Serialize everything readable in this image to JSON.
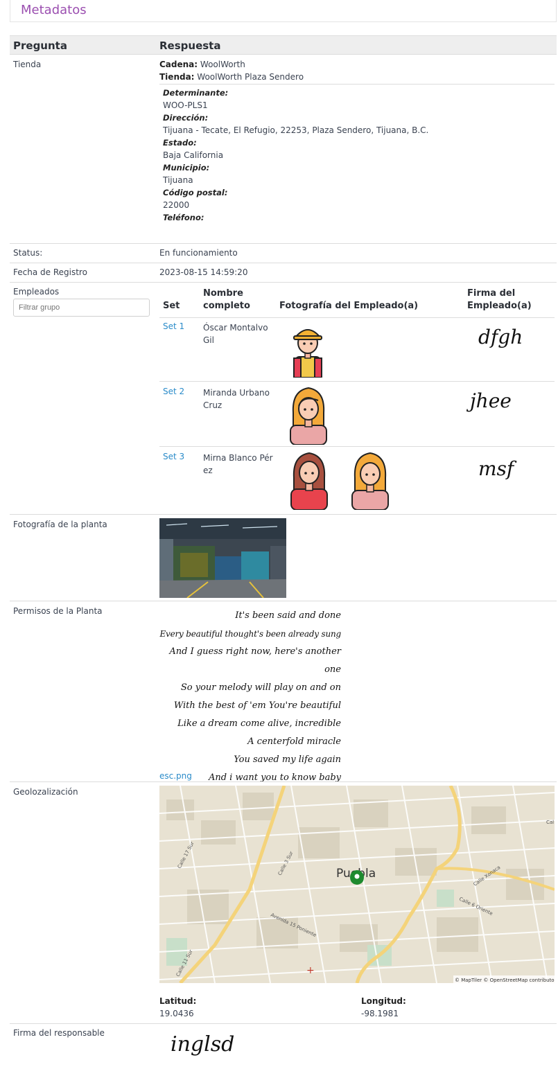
{
  "panel": {
    "title": "Metadatos"
  },
  "table": {
    "col_question": "Pregunta",
    "col_answer": "Respuesta"
  },
  "store": {
    "label": "Tienda",
    "chain_label": "Cadena:",
    "chain_value": "WoolWorth",
    "store_label": "Tienda:",
    "store_value": "WoolWorth Plaza Sendero",
    "fields": [
      {
        "label": "Determinante:",
        "value": "WOO-PLS1"
      },
      {
        "label": "Dirección:",
        "value": "Tijuana - Tecate, El Refugio, 22253, Plaza Sendero, Tijuana, B.C."
      },
      {
        "label": "Estado:",
        "value": "Baja California"
      },
      {
        "label": "Municipio:",
        "value": "Tijuana"
      },
      {
        "label": "Código postal:",
        "value": "22000"
      },
      {
        "label": "Teléfono:",
        "value": ""
      }
    ]
  },
  "status": {
    "label": "Status:",
    "value": "En funcionamiento"
  },
  "registro": {
    "label": "Fecha de Registro",
    "value": "2023-08-15 14:59:20"
  },
  "empleados": {
    "label": "Empleados",
    "filter_placeholder": "Filtrar grupo",
    "headers": {
      "set": "Set",
      "name_1": "Nombre",
      "name_2": "completo",
      "photo": "Fotografía del Empleado(a)",
      "sig_1": "Firma del",
      "sig_2": "Empleado(a)"
    },
    "rows": [
      {
        "set": "Set 1",
        "name_1": "Óscar Montalvo",
        "name_2": "Gil",
        "signature": "dfgh"
      },
      {
        "set": "Set 2",
        "name_1": "Miranda Urbano",
        "name_2": "Cruz",
        "signature": "jhee"
      },
      {
        "set": "Set 3",
        "name_1": "Mirna Blanco Pér",
        "name_2": "ez",
        "signature": "msf"
      }
    ]
  },
  "planta_foto": {
    "label": "Fotografía de la planta"
  },
  "permisos": {
    "label": "Permisos de la Planta",
    "lines": [
      "It's been said and done",
      "Every beautiful thought's been already sung",
      "And I guess right now, here's another one",
      "So your melody will play on and on",
      "With the best of 'em You're beautiful",
      "Like a dream come alive, incredible",
      "A centerfold miracle",
      "You saved my life again",
      "And i want you to know baby"
    ],
    "file_link": "esc.png"
  },
  "geo": {
    "label": "Geolozalización",
    "city": "Puebla",
    "streets": [
      "Calle 17 Sur",
      "Calle 3 Sur",
      "Avenida 15 Poniente",
      "Calle 11 Sur",
      "Calle Xonaca",
      "Calle 6 Oriente",
      "Cal"
    ],
    "attribution": "© MapTiler © OpenStreetMap contributors",
    "lat_label": "Latitud:",
    "lat_value": "19.0436",
    "lon_label": "Longitud:",
    "lon_value": "-98.1981"
  },
  "responsable": {
    "label": "Firma del responsable",
    "signature": "inglsd"
  },
  "colors": {
    "title": "#9b4fb0",
    "link": "#2a8bc9",
    "marker": "#1e8a2e"
  }
}
